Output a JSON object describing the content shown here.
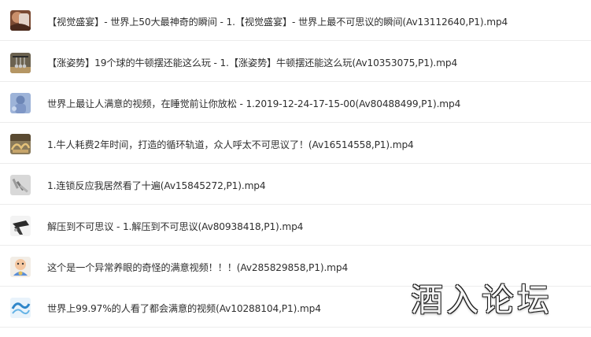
{
  "files": [
    {
      "name": "【视觉盛宴】- 世界上50大最神奇的瞬间 - 1.【视觉盛宴】- 世界上最不可思议的瞬间(Av13112640,P1).mp4",
      "thumbnail": "thumbnail-portrait-brown"
    },
    {
      "name": "【涨姿势】19个球的牛顿摆还能这么玩 - 1.【涨姿势】牛顿摆还能这么玩(Av10353075,P1).mp4",
      "thumbnail": "thumbnail-newtons-cradle"
    },
    {
      "name": "世界上最让人满意的视频，在睡觉前让你放松 - 1.2019-12-24-17-15-00(Av80488499,P1).mp4",
      "thumbnail": "thumbnail-blue-figure"
    },
    {
      "name": "1.牛人耗费2年时间，打造的循环轨道，众人呼太不可思议了！(Av16514558,P1).mp4",
      "thumbnail": "thumbnail-track-machine"
    },
    {
      "name": "1.连锁反应我居然看了十遍(Av15845272,P1).mp4",
      "thumbnail": "thumbnail-gray-dominoes"
    },
    {
      "name": "解压到不可思议 - 1.解压到不可思议(Av80938418,P1).mp4",
      "thumbnail": "thumbnail-dark-object"
    },
    {
      "name": "这个是一个异常养眼的奇怪的满意视频！！！(Av285829858,P1).mp4",
      "thumbnail": "thumbnail-cartoon-face"
    },
    {
      "name": "世界上99.97%的人看了都会满意的视频(Av10288104,P1).mp4",
      "thumbnail": "thumbnail-blue-swirl"
    }
  ],
  "watermark": "酒入论坛"
}
